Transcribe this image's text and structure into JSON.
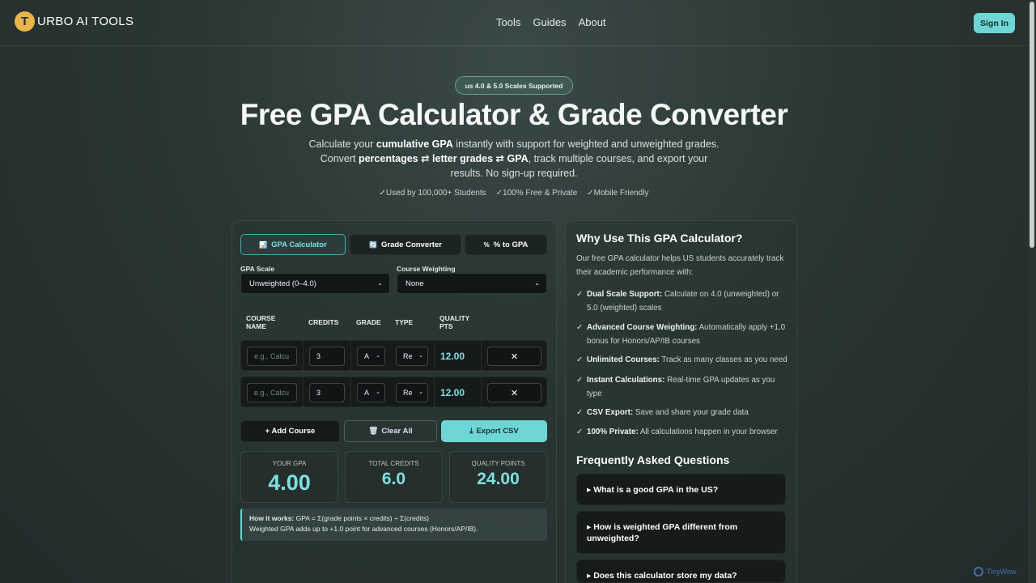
{
  "header": {
    "logo_letter": "T",
    "logo_text": "URBO AI TOOLS",
    "nav": [
      "Tools",
      "Guides",
      "About"
    ],
    "signin_label": "Sign In"
  },
  "hero": {
    "badge": "us 4.0 & 5.0 Scales Supported",
    "title": "Free GPA Calculator & Grade Converter",
    "sub_1a": "Calculate your ",
    "sub_1b": "cumulative GPA",
    "sub_1c": " instantly with support for weighted and unweighted grades.",
    "sub_2a": "Convert ",
    "sub_2b": "percentages ⇄ letter grades ⇄ GPA",
    "sub_2c": ", track multiple courses, and export your results. No sign-up required.",
    "trust": [
      "✓Used by 100,000+ Students",
      "✓100% Free & Private",
      "✓Mobile Friendly"
    ]
  },
  "calc": {
    "tabs": [
      {
        "icon": "📊",
        "label": "GPA Calculator"
      },
      {
        "icon": "🔄",
        "label": "Grade Converter"
      },
      {
        "icon": "%",
        "label": "% to GPA"
      }
    ],
    "scale_label": "GPA Scale",
    "scale_value": "Unweighted (0–4.0)",
    "weight_label": "Course Weighting",
    "weight_value": "None",
    "headers": {
      "course": "Course Name",
      "credits": "Credits",
      "grade": "Grade",
      "type": "Type",
      "qp": "Quality Pts"
    },
    "rows": [
      {
        "placeholder": "e.g., Calcu",
        "credits": "3",
        "grade": "A",
        "type": "Re",
        "qp": "12.00",
        "delete": "✕"
      },
      {
        "placeholder": "e.g., Calcu",
        "credits": "3",
        "grade": "A",
        "type": "Re",
        "qp": "12.00",
        "delete": "✕"
      }
    ],
    "add_label": "+ Add Course",
    "clear_label": "Clear All",
    "export_label": "Export CSV",
    "stats": {
      "gpa_label": "Your GPA",
      "gpa_value": "4.00",
      "credits_label": "Total Credits",
      "credits_value": "6.0",
      "qp_label": "Quality Points",
      "qp_value": "24.00"
    },
    "note_bold": "How it works:",
    "note_1": " GPA = Σ(grade points × credits) ÷ Σ(credits)",
    "note_2": "Weighted GPA adds up to +1.0 point for advanced courses (Honors/AP/IB)."
  },
  "info": {
    "title": "Why Use This GPA Calculator?",
    "intro": "Our free GPA calculator helps US students accurately track their academic performance with:",
    "features": [
      {
        "bold": "Dual Scale Support:",
        "text": " Calculate on 4.0 (unweighted) or 5.0 (weighted) scales"
      },
      {
        "bold": "Advanced Course Weighting:",
        "text": " Automatically apply +1.0 bonus for Honors/AP/IB courses"
      },
      {
        "bold": "Unlimited Courses:",
        "text": " Track as many classes as you need"
      },
      {
        "bold": "Instant Calculations:",
        "text": " Real-time GPA updates as you type"
      },
      {
        "bold": "CSV Export:",
        "text": " Save and share your grade data"
      },
      {
        "bold": "100% Private:",
        "text": " All calculations happen in your browser"
      }
    ],
    "check": "✓",
    "faq_title": "Frequently Asked Questions",
    "faqs": [
      "▸ What is a good GPA in the US?",
      "▸ How is weighted GPA different from unweighted?",
      "▸ Does this calculator store my data?"
    ]
  },
  "watermark": "TinyWow"
}
